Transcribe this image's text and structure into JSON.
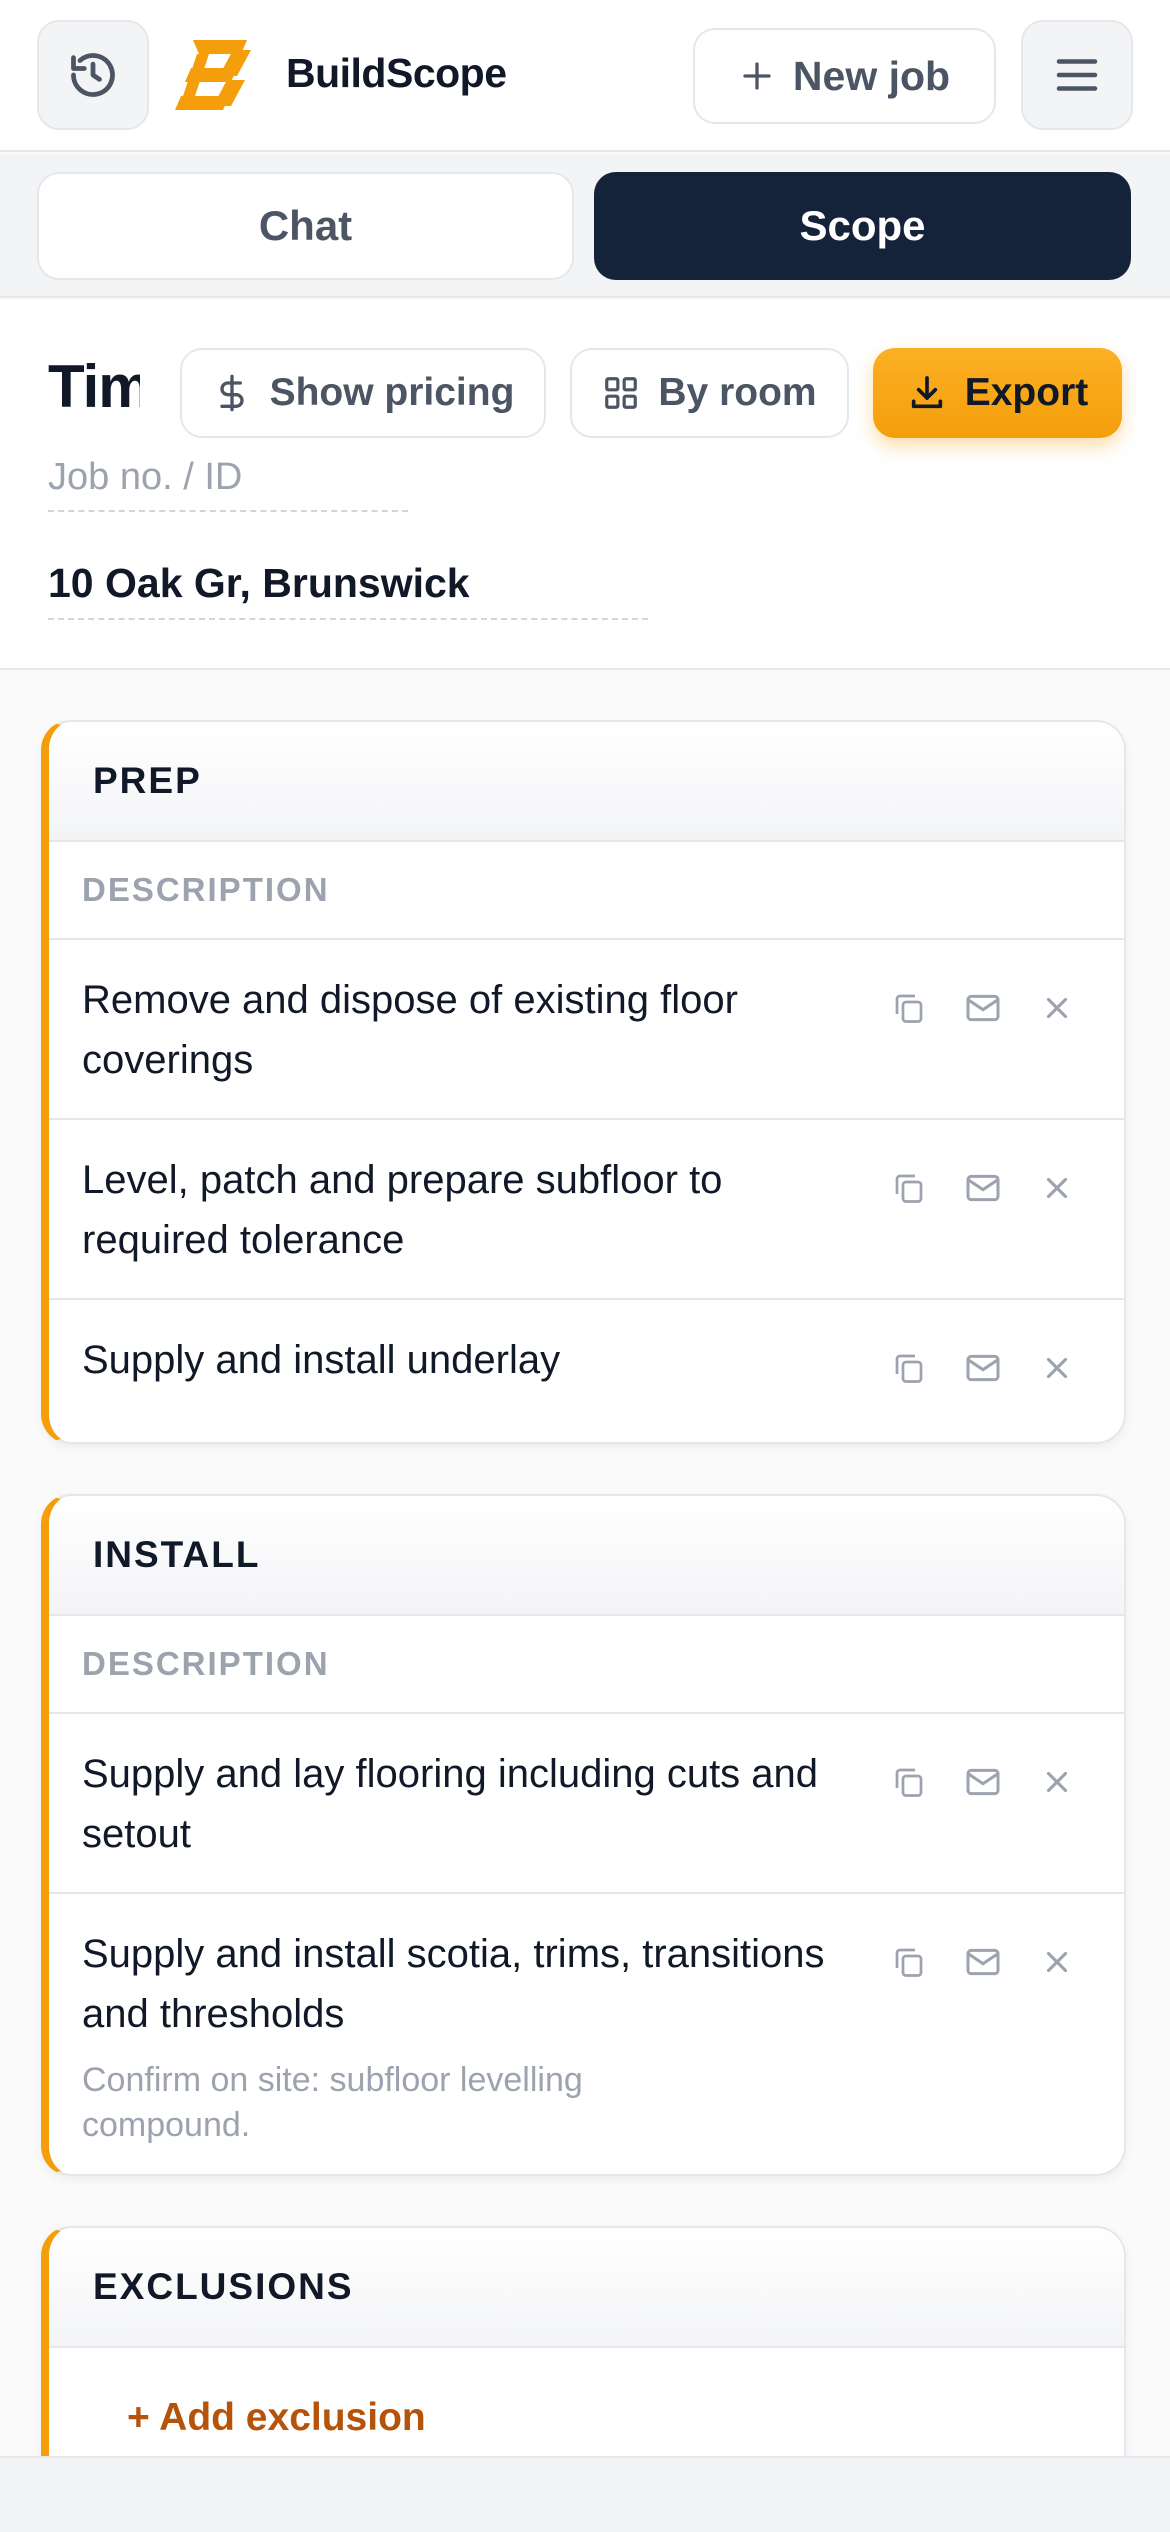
{
  "header": {
    "brand": "BuildScope",
    "new_job_label": "New job",
    "icons": {
      "history": "history-icon",
      "plus": "plus-icon",
      "menu": "hamburger-menu-icon"
    },
    "logo": "buildscope-logo"
  },
  "tabs": [
    {
      "label": "Chat",
      "active": false
    },
    {
      "label": "Scope",
      "active": true
    }
  ],
  "toolbar": {
    "title": "Tim",
    "show_pricing_label": "Show pricing",
    "by_room_label": "By room",
    "export_label": "Export"
  },
  "job": {
    "job_no_placeholder": "Job no. / ID",
    "address": "10 Oak Gr, Brunswick"
  },
  "sections": [
    {
      "title": "PREP",
      "column_header": "DESCRIPTION",
      "items": [
        {
          "text": "Remove and dispose of existing floor coverings"
        },
        {
          "text": "Level, patch and prepare subfloor to required tolerance"
        },
        {
          "text": "Supply and install underlay"
        }
      ]
    },
    {
      "title": "INSTALL",
      "column_header": "DESCRIPTION",
      "items": [
        {
          "text": "Supply and lay flooring including cuts and setout"
        },
        {
          "text": "Supply and install scotia, trims, transitions and thresholds",
          "note": "Confirm on site: subfloor levelling compound."
        }
      ]
    },
    {
      "title": "EXCLUSIONS",
      "add_label": "+ Add exclusion"
    }
  ],
  "colors": {
    "accent": "#f59e0b",
    "dark": "#15233a",
    "link": "#b45309"
  }
}
